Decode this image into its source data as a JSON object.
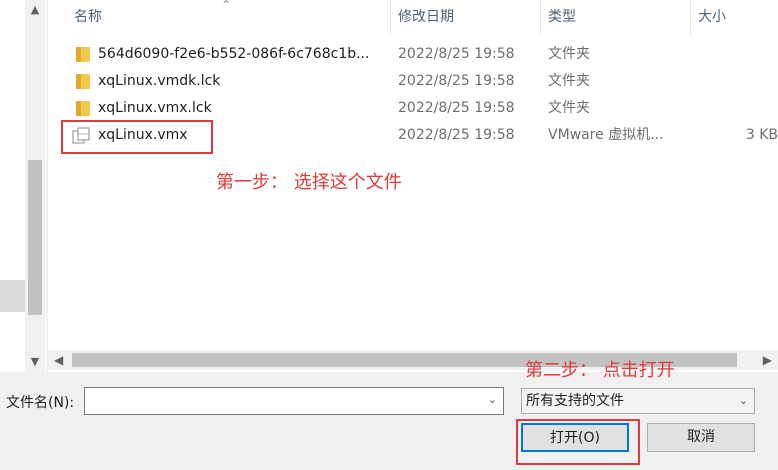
{
  "header": {
    "name": "名称",
    "date": "修改日期",
    "type": "类型",
    "size": "大小"
  },
  "files": [
    {
      "name": "564d6090-f2e6-b552-086f-6c768c1b...",
      "date": "2022/8/25 19:58",
      "type": "文件夹",
      "size": "",
      "icon": "folder-icon"
    },
    {
      "name": "xqLinux.vmdk.lck",
      "date": "2022/8/25 19:58",
      "type": "文件夹",
      "size": "",
      "icon": "folder-icon"
    },
    {
      "name": "xqLinux.vmx.lck",
      "date": "2022/8/25 19:58",
      "type": "文件夹",
      "size": "",
      "icon": "folder-icon"
    },
    {
      "name": "xqLinux.vmx",
      "date": "2022/8/25 19:58",
      "type": "VMware 虚拟机...",
      "size": "3 KB",
      "icon": "vmx-file-icon"
    }
  ],
  "annotations": {
    "step1": "第一步： 选择这个文件",
    "step2": "第二步： 点击打开"
  },
  "footer": {
    "filename_label": "文件名(N):",
    "filename_value": "",
    "filter_value": "所有支持的文件",
    "open_label": "打开(O)",
    "cancel_label": "取消"
  },
  "colors": {
    "annotation_red": "#e03a3a",
    "accent_blue": "#0078d7",
    "header_text": "#4c607a"
  }
}
